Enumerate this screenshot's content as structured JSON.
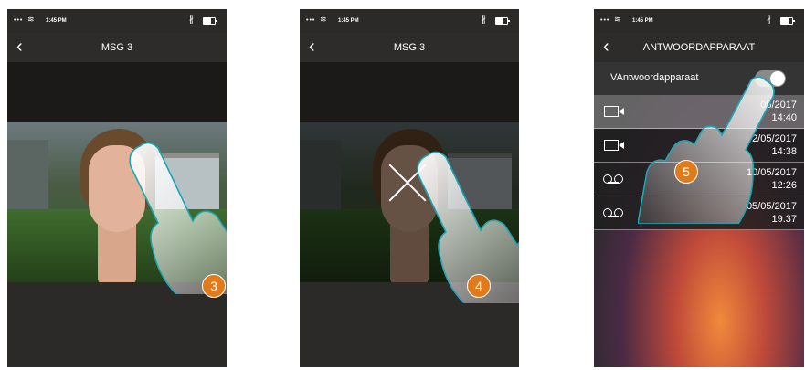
{
  "status": {
    "time": "1:45 PM"
  },
  "screen1": {
    "title": "MSG 3",
    "step": "3"
  },
  "screen2": {
    "title": "MSG 3",
    "step": "4"
  },
  "screen3": {
    "title": "ANTWOORDAPPARAAT",
    "toggle_label": "VAntwoordapparaat",
    "toggle_on": true,
    "step": "5",
    "messages": [
      {
        "type": "video",
        "icon": "video-camera-icon",
        "date": "05/2017",
        "time": "14:40"
      },
      {
        "type": "video",
        "icon": "video-camera-icon",
        "date": "2/05/2017",
        "time": "14:38"
      },
      {
        "type": "voicemail",
        "icon": "voicemail-icon",
        "date": "10/05/2017",
        "time": "12:26"
      },
      {
        "type": "voicemail",
        "icon": "voicemail-icon",
        "date": "05/05/2017",
        "time": "19:37"
      }
    ]
  },
  "colors": {
    "badge": "#e07b1c",
    "hand_outline": "#1aa7b5"
  }
}
